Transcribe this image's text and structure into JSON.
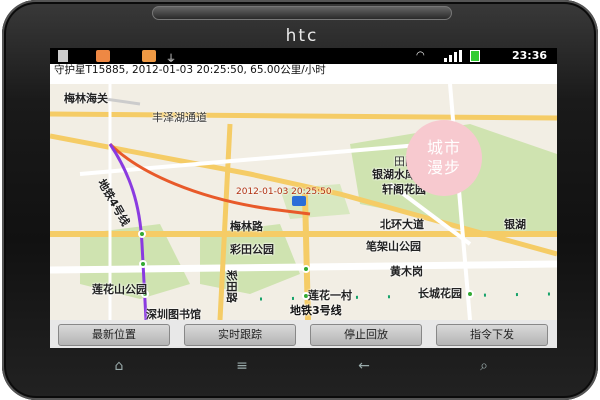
{
  "device": {
    "brand": "htc"
  },
  "status_bar": {
    "time": "23:36",
    "icons": [
      "app-icon-1",
      "app-icon-2",
      "usb-icon",
      "wifi-icon",
      "signal-icon",
      "battery-icon"
    ]
  },
  "info_bar": {
    "text": "守护星T15885, 2012-01-03 20:25:50, 65.00公里/小时"
  },
  "map": {
    "badge": {
      "line1": "城市",
      "line2": "漫步"
    },
    "labels": {
      "meilin": "梅林海关",
      "fengze": "丰泽湖通道",
      "tianyuan": "田园居",
      "yinhu": "银湖水库",
      "xuange": "轩阁花园",
      "track_time": "2012-01-03 20:25:50",
      "meilin_road": "梅林路",
      "beihuan": "北环大道",
      "yinhu2": "银湖",
      "caitian_park": "彩田公园",
      "bijia": "笔架山公园",
      "huangmu": "黄木岗",
      "lianhua_park": "莲花山公园",
      "library": "深圳图书馆",
      "metro3": "地铁3号线",
      "lianhua_yicun": "莲花一村",
      "changcheng": "长城花园",
      "caitian_road": "彩田路",
      "line4": "地铁4号线"
    }
  },
  "buttons": {
    "latest": "最新位置",
    "track": "实时跟踪",
    "stop": "停止回放",
    "command": "指令下发"
  },
  "navkeys": {
    "home": "⌂",
    "menu": "≡",
    "back": "←",
    "search": "⌕"
  }
}
